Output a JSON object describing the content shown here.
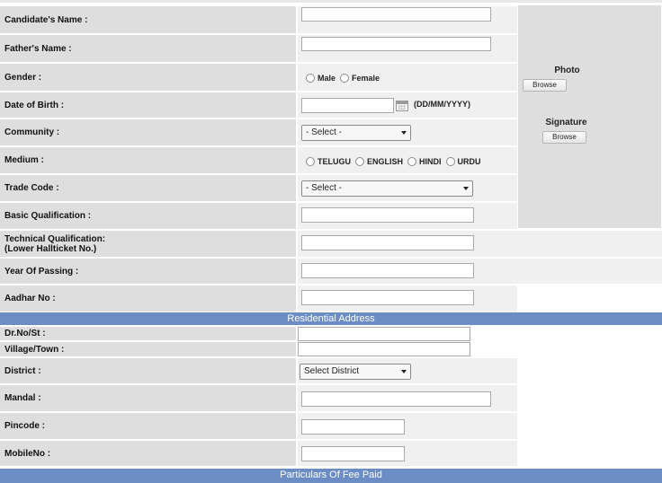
{
  "form": {
    "candidate_name": {
      "label": "Candidate's Name :",
      "value": ""
    },
    "father_name": {
      "label": "Father's Name :",
      "value": ""
    },
    "gender": {
      "label": "Gender :",
      "options": [
        "Male",
        "Female"
      ]
    },
    "dob": {
      "label": "Date of Birth :",
      "value": "",
      "hint": "(DD/MM/YYYY)"
    },
    "community": {
      "label": "Community :",
      "selected": "- Select -"
    },
    "medium": {
      "label": "Medium :",
      "options": [
        "TELUGU",
        "ENGLISH",
        "HINDI",
        "URDU"
      ]
    },
    "trade_code": {
      "label": "Trade Code :",
      "selected": "- Select -"
    },
    "basic_qualification": {
      "label": "Basic Qualification :",
      "value": ""
    },
    "technical_qualification": {
      "label_line1": "Technical Qualification:",
      "label_line2": "(Lower Hallticket No.)",
      "value": ""
    },
    "year_of_passing": {
      "label": "Year Of Passing :",
      "value": ""
    },
    "aadhar": {
      "label": "Aadhar No :",
      "value": ""
    }
  },
  "photo_panel": {
    "photo_label": "Photo",
    "photo_button": "Browse",
    "signature_label": "Signature",
    "signature_button": "Browse"
  },
  "residential": {
    "title": "Residential Address",
    "dr_no": {
      "label": "Dr.No/St :",
      "value": ""
    },
    "village": {
      "label": "Village/Town :",
      "value": ""
    },
    "district": {
      "label": "District :",
      "selected": "Select District"
    },
    "mandal": {
      "label": "Mandal :",
      "value": ""
    },
    "pincode": {
      "label": "Pincode :",
      "value": ""
    },
    "mobile": {
      "label": "MobileNo :",
      "value": ""
    }
  },
  "fee_section": {
    "title": "Particulars Of Fee Paid"
  }
}
